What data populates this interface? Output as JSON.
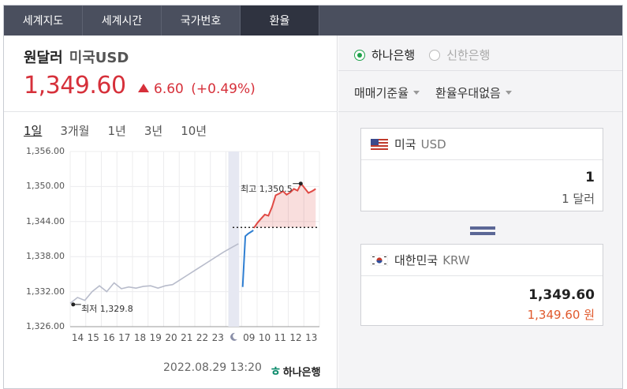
{
  "tabs": [
    {
      "label": "세계지도"
    },
    {
      "label": "세계시간"
    },
    {
      "label": "국가번호"
    },
    {
      "label": "환율",
      "active": true
    }
  ],
  "header": {
    "title": "원달러",
    "subtitle": "미국USD",
    "rate": "1,349.60",
    "change": "6.60",
    "change_pct": "(+0.49%)",
    "direction": "up",
    "color_up": "#d6303a"
  },
  "periods": [
    {
      "label": "1일",
      "active": true
    },
    {
      "label": "3개월"
    },
    {
      "label": "1년"
    },
    {
      "label": "3년"
    },
    {
      "label": "10년"
    }
  ],
  "chart_data": {
    "type": "line",
    "y_ticks": [
      "1,356.00",
      "1,350.00",
      "1,344.00",
      "1,338.00",
      "1,332.00",
      "1,326.00"
    ],
    "ylim": [
      1326,
      1356
    ],
    "x_ticks": [
      "14",
      "15",
      "16",
      "17",
      "18",
      "19",
      "20",
      "21",
      "22",
      "23",
      "moon",
      "09",
      "10",
      "11",
      "12",
      "13"
    ],
    "high_label": "최고 1,350.5",
    "low_label": "최저 1,329.8",
    "high": 1350.5,
    "low": 1329.8,
    "previous_close": 1343.0,
    "series": [
      {
        "values": [
          1330.0,
          1331.0,
          1330.5,
          1332.0,
          1333.0,
          1332.0,
          1333.5,
          1332.5,
          1332.8,
          1332.6,
          1332.9,
          1333.0,
          1332.6,
          1333.0,
          1333.2,
          1334.0,
          1334.8,
          1335.6,
          1336.4,
          1337.2,
          1338.0,
          1338.8,
          1339.5,
          1340.2
        ],
        "color": "#b8bccb"
      },
      {
        "values": [
          1332.8,
          1341.5,
          1341.9,
          1342.2,
          1342.5
        ],
        "color": "#2f7fd2"
      },
      {
        "values": [
          1342.9,
          1343.8,
          1344.5,
          1345.2,
          1345.0,
          1346.5,
          1348.5,
          1348.8,
          1349.2,
          1348.6,
          1349.0,
          1349.6,
          1349.3,
          1350.5,
          1349.7,
          1348.9,
          1349.2,
          1349.6
        ],
        "color": "#e04a45"
      }
    ]
  },
  "timestamp": "2022.08.29 13:20",
  "bank_logo": "하나은행",
  "banks": [
    {
      "label": "하나은행",
      "selected": true
    },
    {
      "label": "신한은행",
      "selected": false
    }
  ],
  "options": [
    {
      "label": "매매기준율"
    },
    {
      "label": "환율우대없음"
    }
  ],
  "converter": {
    "from": {
      "country": "미국",
      "code": "USD",
      "flag": "us-flag-icon",
      "value": "1",
      "sub": "1 달러"
    },
    "to": {
      "country": "대한민국",
      "code": "KRW",
      "flag": "kr-flag-icon",
      "value": "1,349.60",
      "sub": "1,349.60 원",
      "sub_color": "#e0592c"
    }
  }
}
